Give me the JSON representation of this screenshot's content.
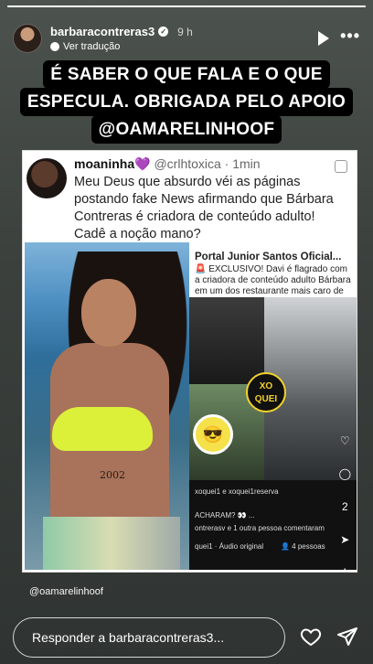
{
  "story": {
    "progress": 1.0,
    "username": "barbaracontreras3",
    "time": "9 h",
    "translate_label": "Ver tradução",
    "caption_lines": [
      "É SABER O QUE FALA E O QUE",
      "ESPECULA. OBRIGADA PELO APOIO",
      "@OAMARELINHOOF"
    ],
    "mention": "@oamarelinhoof",
    "reply_placeholder": "Responder a barbaracontreras3..."
  },
  "tweet": {
    "name": "moaninha",
    "handle": "@crlhtoxica · 1min",
    "text": "Meu Deus que absurdo véi as páginas postando fake News afirmando que Bárbara Contreras é criadora de conteúdo adulto! Cadê a noção mano?"
  },
  "embedded_post": {
    "title": "Portal Junior Santos Oficial...",
    "body": "🚨 EXCLUSIVO! Davi é flagrado com a criadora de conteúdo adulto Bárbara em um dos restaurante mais caro de Salvado",
    "badge": "XO QUEI",
    "tattoo": "2002",
    "line1": "xoquei1 e xoquei1reserva",
    "line2": "ACHARAM? 👀 ...",
    "line3": "ontrerasv e 1 outra pessoa comentaram",
    "line4": "quei1 · Áudio original",
    "line5": "👤 4 pessoas",
    "comment_count": "2"
  },
  "colors": {
    "accent_heart": "#a25bd6",
    "badge_yellow": "#f2d22a",
    "bikini": "#dcf03a"
  }
}
